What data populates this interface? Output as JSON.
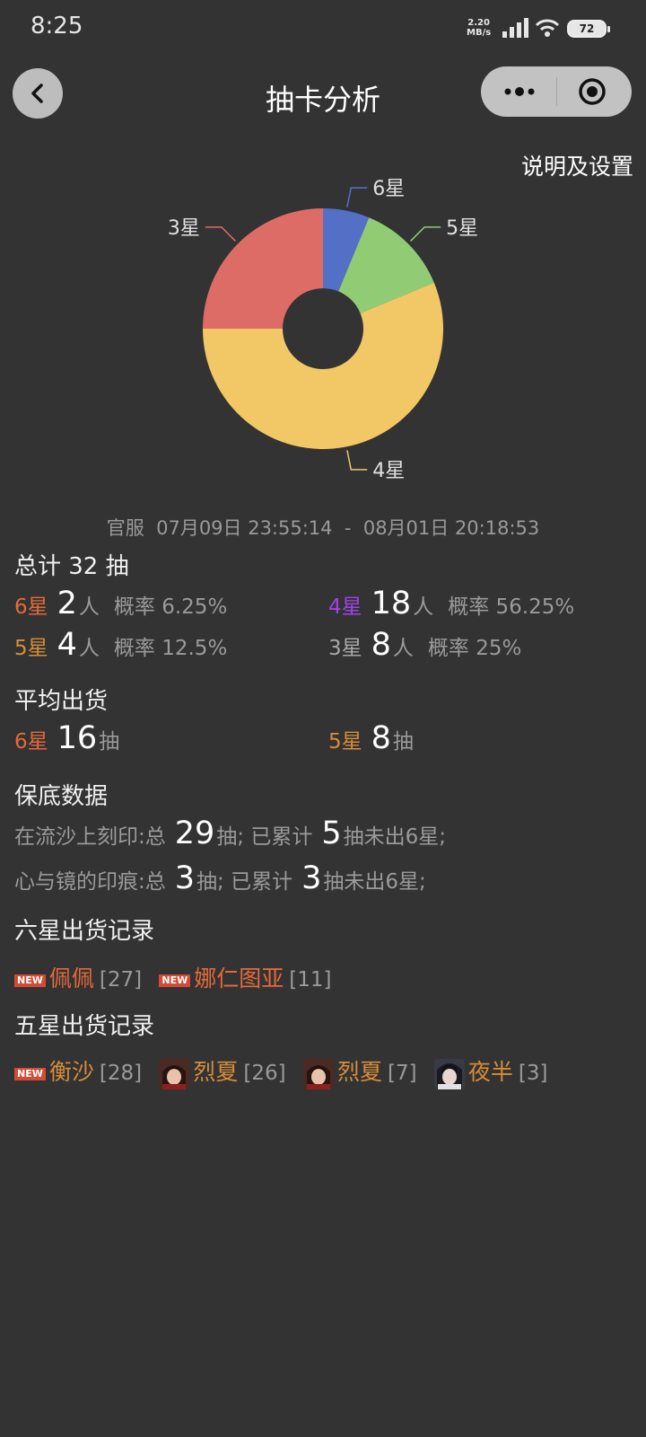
{
  "status": {
    "time": "8:25",
    "net_rate": "2.20",
    "net_unit": "MB/s",
    "battery": "72"
  },
  "nav": {
    "title": "抽卡分析"
  },
  "settings_link": "说明及设置",
  "chart_data": {
    "type": "pie",
    "donut": true,
    "labels": [
      "6星",
      "5星",
      "4星",
      "3星"
    ],
    "values": [
      2,
      4,
      18,
      8
    ],
    "colors": [
      "#5470c6",
      "#91cc75",
      "#f2c866",
      "#de6c66"
    ]
  },
  "range": {
    "server": "官服",
    "start": "07月09日 23:55:14",
    "sep": "-",
    "end": "08月01日 20:18:53"
  },
  "total": {
    "label": "总计 32 抽"
  },
  "stars": [
    {
      "star": "6星",
      "count": "2",
      "unit": "人",
      "rate": "概率 6.25%",
      "color": "#e26a3a"
    },
    {
      "star": "4星",
      "count": "18",
      "unit": "人",
      "rate": "概率 56.25%",
      "color": "#a044e6"
    },
    {
      "star": "5星",
      "count": "4",
      "unit": "人",
      "rate": "概率 12.5%",
      "color": "#d68d38"
    },
    {
      "star": "3星",
      "count": "8",
      "unit": "人",
      "rate": "概率 25%",
      "color": "#a8a8a8"
    }
  ],
  "average": {
    "title": "平均出货",
    "six": {
      "star": "6星",
      "value": "16",
      "unit": "抽"
    },
    "five": {
      "star": "5星",
      "value": "8",
      "unit": "抽"
    }
  },
  "pity": {
    "title": "保底数据",
    "rows": [
      {
        "pool": "在流沙上刻印:总",
        "total": "29",
        "mid": "抽; 已累计",
        "acc": "5",
        "tail": "抽未出6星;"
      },
      {
        "pool": "心与镜的印痕:总",
        "total": "3",
        "mid": "抽; 已累计",
        "acc": "3",
        "tail": "抽未出6星;"
      }
    ]
  },
  "six_record": {
    "title": "六星出货记录",
    "items": [
      {
        "badge": "NEW",
        "name": "佩佩",
        "count": "[27]"
      },
      {
        "badge": "NEW",
        "name": "娜仁图亚",
        "count": "[11]"
      }
    ]
  },
  "five_record": {
    "title": "五星出货记录",
    "items": [
      {
        "badge": "NEW",
        "name": "衡沙",
        "count": "[28]"
      },
      {
        "avatar": "character-avatar",
        "name": "烈夏",
        "count": "[26]"
      },
      {
        "avatar": "character-avatar",
        "name": "烈夏",
        "count": "[7]"
      },
      {
        "avatar": "character-avatar",
        "name": "夜半",
        "count": "[3]"
      }
    ]
  }
}
